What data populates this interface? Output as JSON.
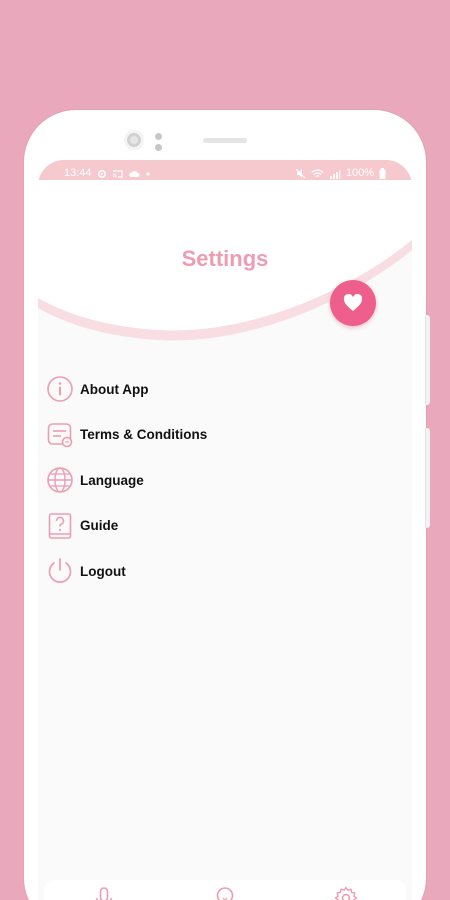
{
  "status_bar": {
    "time": "13:44",
    "battery": "100%"
  },
  "header": {
    "title": "Settings"
  },
  "menu": {
    "items": [
      {
        "label": "About App",
        "icon": "info-icon"
      },
      {
        "label": "Terms & Conditions",
        "icon": "document-icon"
      },
      {
        "label": "Language",
        "icon": "globe-icon"
      },
      {
        "label": "Guide",
        "icon": "help-book-icon"
      },
      {
        "label": "Logout",
        "icon": "power-icon"
      }
    ]
  },
  "bottom_nav": {
    "items": [
      {
        "icon": "microphone-icon"
      },
      {
        "icon": "lightbulb-icon"
      },
      {
        "icon": "gear-icon"
      }
    ]
  },
  "colors": {
    "background": "#e9a8bb",
    "accent": "#ee9cb3",
    "fab": "#ee5f8e",
    "status_bar": "#f5c9ce"
  }
}
